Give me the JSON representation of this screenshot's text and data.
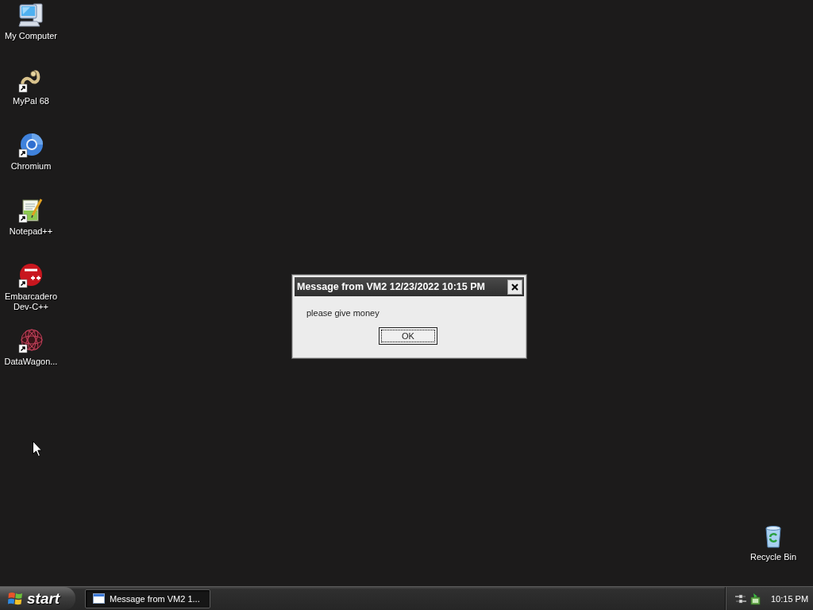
{
  "desktop": {
    "icons": [
      {
        "label": "My Computer",
        "kind": "computer",
        "shortcut": false
      },
      {
        "label": "MyPal 68",
        "kind": "animal",
        "shortcut": true
      },
      {
        "label": "Chromium",
        "kind": "ring",
        "shortcut": true
      },
      {
        "label": "Notepad++",
        "kind": "notepad",
        "shortcut": true
      },
      {
        "label": "Embarcadero Dev-C++",
        "kind": "disc",
        "shortcut": true
      },
      {
        "label": "DataWagon...",
        "kind": "mesh",
        "shortcut": true
      }
    ],
    "recycle_bin": {
      "label": "Recycle Bin"
    }
  },
  "dialog": {
    "title": "Message from VM2 12/23/2022 10:15 PM",
    "message": "please give money",
    "buttons": [
      "OK"
    ]
  },
  "taskbar": {
    "start_label": "start",
    "tasks": [
      {
        "label": "Message from VM2 1...",
        "selected": true
      }
    ],
    "clock": "10:15 PM"
  }
}
